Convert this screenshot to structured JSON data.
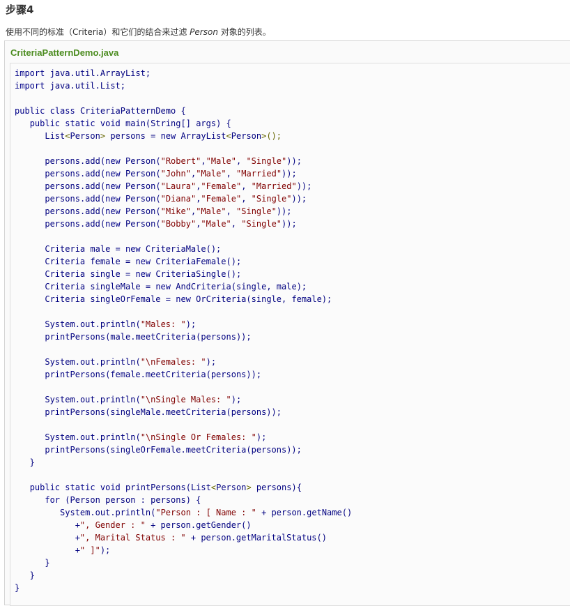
{
  "step": {
    "title": "步骤4"
  },
  "description": {
    "before": "使用不同的标准（Criteria）和它们的结合来过滤 ",
    "emphasis": "Person",
    "after": " 对象的列表。"
  },
  "code_block": {
    "filename": "CriteriaPatternDemo.java",
    "lines": [
      "import java.util.ArrayList;",
      "import java.util.List;",
      "",
      "public class CriteriaPatternDemo {",
      "   public static void main(String[] args) {",
      "      List<Person> persons = new ArrayList<Person>();",
      "",
      "      persons.add(new Person(\"Robert\",\"Male\", \"Single\"));",
      "      persons.add(new Person(\"John\",\"Male\", \"Married\"));",
      "      persons.add(new Person(\"Laura\",\"Female\", \"Married\"));",
      "      persons.add(new Person(\"Diana\",\"Female\", \"Single\"));",
      "      persons.add(new Person(\"Mike\",\"Male\", \"Single\"));",
      "      persons.add(new Person(\"Bobby\",\"Male\", \"Single\"));",
      "",
      "      Criteria male = new CriteriaMale();",
      "      Criteria female = new CriteriaFemale();",
      "      Criteria single = new CriteriaSingle();",
      "      Criteria singleMale = new AndCriteria(single, male);",
      "      Criteria singleOrFemale = new OrCriteria(single, female);",
      "",
      "      System.out.println(\"Males: \");",
      "      printPersons(male.meetCriteria(persons));",
      "",
      "      System.out.println(\"\\nFemales: \");",
      "      printPersons(female.meetCriteria(persons));",
      "",
      "      System.out.println(\"\\nSingle Males: \");",
      "      printPersons(singleMale.meetCriteria(persons));",
      "",
      "      System.out.println(\"\\nSingle Or Females: \");",
      "      printPersons(singleOrFemale.meetCriteria(persons));",
      "   }",
      "",
      "   public static void printPersons(List<Person> persons){",
      "      for (Person person : persons) {",
      "         System.out.println(\"Person : [ Name : \" + person.getName()",
      "            +\", Gender : \" + person.getGender()",
      "            +\", Marital Status : \" + person.getMaritalStatus()",
      "            +\" ]\");",
      "      }",
      "   }",
      "}"
    ]
  },
  "colors": {
    "filename": "#4c8c20",
    "code_text": "#000080",
    "keyword": "#000088",
    "string": "#800000",
    "punctuation": "#666600"
  }
}
